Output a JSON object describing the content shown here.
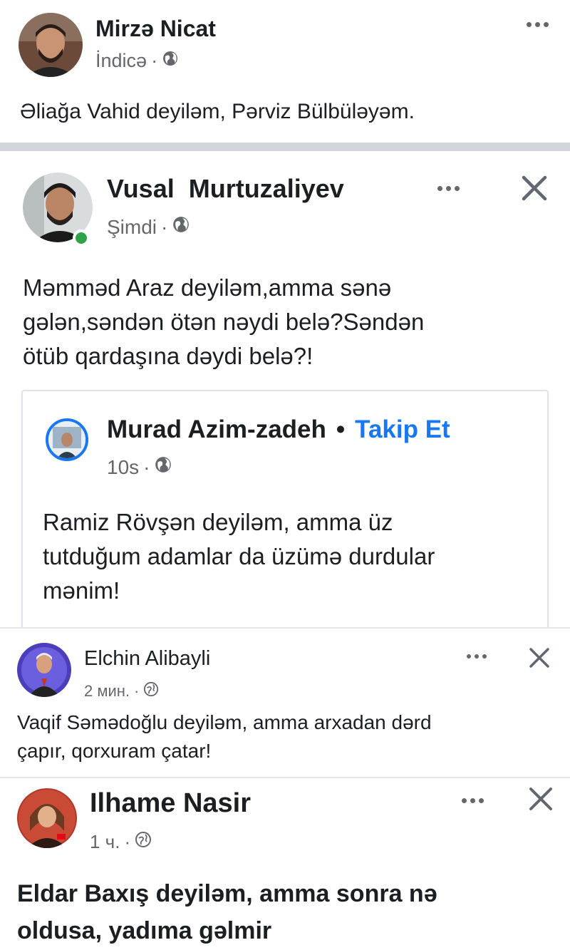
{
  "post1": {
    "author": "Mirzə Nicat",
    "time": "İndicə",
    "separator": "·",
    "text": "Əliağa Vahid deyiləm, Pərviz Bülbüləyəm."
  },
  "post2": {
    "author": "Vusal  Murtuzaliyev",
    "time": "Şimdi",
    "separator": "·",
    "text_lines": [
      "Məmməd Araz deyiləm,amma sənə",
      "gələn,səndən ötən nəydi belə?Səndən",
      "ötüb qardaşına dəydi belə?!"
    ],
    "shared": {
      "author": "Murad Azim-zadeh",
      "bullet": "•",
      "follow_label": "Takip Et",
      "time": "10s",
      "separator": "·",
      "text_lines": [
        "Ramiz Rövşən deyiləm, amma üz",
        "tutduğum adamlar da üzümə durdular",
        "mənim!"
      ]
    }
  },
  "post3": {
    "author": "Elchin Alibayli",
    "time": "2 мин.",
    "separator": "·",
    "text_lines": [
      "Vaqif Səmədoğlu deyiləm, amma arxadan dərd",
      "çapır, qorxuram çatar!"
    ]
  },
  "post4": {
    "author": "Ilhame Nasir",
    "time": "1 ч.",
    "separator": "·",
    "text_lines": [
      "Eldar Baxış deyiləm, amma sonra nə",
      "oldusa, yadıma gəlmir"
    ]
  },
  "icons": {
    "globe": "globe-icon",
    "more": "more-options-icon",
    "close": "close-icon"
  },
  "colors": {
    "link_blue": "#1877f2",
    "meta_gray": "#65676b",
    "online_green": "#31a24c"
  }
}
